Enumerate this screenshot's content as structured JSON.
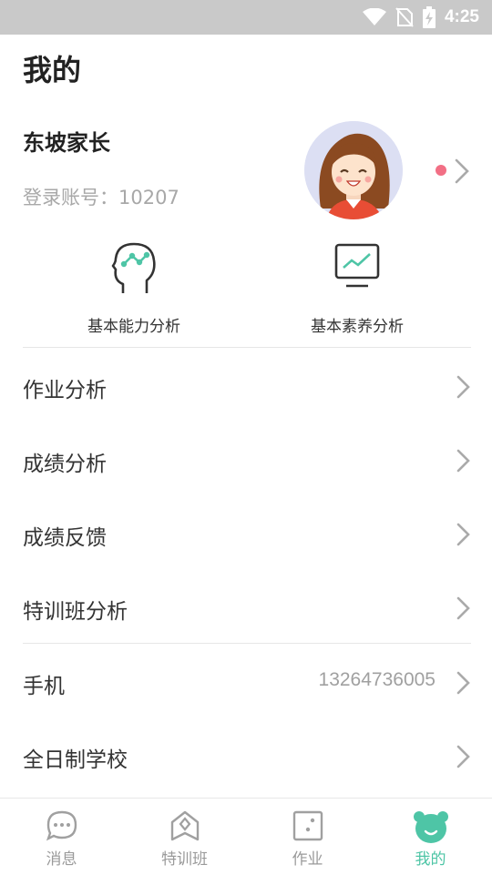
{
  "status_bar": {
    "time": "4:25",
    "icons": [
      "wifi-icon",
      "no-sim-icon",
      "battery-charging-icon"
    ]
  },
  "page": {
    "title": "我的"
  },
  "profile": {
    "name": "东坡家长",
    "account": "登录账号：10207",
    "avatar": "avatar-girl",
    "has_notification_dot": true
  },
  "analysis": [
    {
      "label": "基本能力分析",
      "icon": "brain-chart-icon"
    },
    {
      "label": "基本素养分析",
      "icon": "monitor-chart-icon"
    }
  ],
  "menu": [
    {
      "label": "作业分析",
      "value": ""
    },
    {
      "label": "成绩分析",
      "value": ""
    },
    {
      "label": "成绩反馈",
      "value": ""
    },
    {
      "label": "特训班分析",
      "value": ""
    },
    {
      "label": "手机",
      "value": "13264736005"
    },
    {
      "label": "全日制学校",
      "value": ""
    }
  ],
  "tabbar": {
    "active": "我的",
    "tabs": [
      {
        "label": "消息",
        "icon": "chat-bubble-icon"
      },
      {
        "label": "特训班",
        "icon": "house-diamond-icon"
      },
      {
        "label": "作业",
        "icon": "dice-icon"
      },
      {
        "label": "我的",
        "icon": "bear-face-icon"
      }
    ]
  },
  "colors": {
    "accent": "#4ec5a6",
    "status_bar": "#c9c9c9",
    "notification_dot": "#f26f85",
    "avatar_bg": "#dcdff3"
  }
}
